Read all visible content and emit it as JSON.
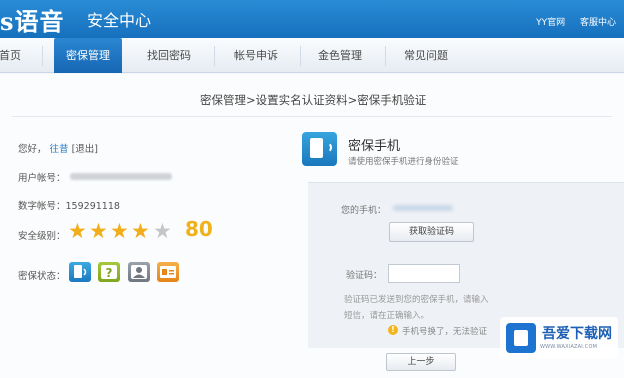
{
  "header": {
    "logo": "s语音",
    "title": "安全中心",
    "links": [
      "YY官网",
      "客服中心"
    ]
  },
  "nav": {
    "items": [
      "首页",
      "密保管理",
      "找回密码",
      "帐号申诉",
      "金色管理",
      "常见问题"
    ],
    "active_index": 1
  },
  "breadcrumb": "密保管理>设置实名认证资料>密保手机验证",
  "left": {
    "greeting": "您好，",
    "username": "往昔",
    "logout": "[退出]",
    "account_label": "用户帐号：",
    "number_label": "数字帐号：",
    "number_value": "159291118",
    "level_label": "安全级别：",
    "stars": 4,
    "stars_total": 5,
    "score": "80",
    "status_label": "密保状态：",
    "status_icons": [
      "phone-icon",
      "question-icon",
      "identity-icon",
      "card-icon"
    ]
  },
  "right": {
    "title": "密保手机",
    "subtitle": "请使用密保手机进行身份验证",
    "phone_label": "您的手机：",
    "get_code_button": "获取验证码",
    "code_label": "验证码：",
    "hint_line1": "验证码已发送到您的密保手机，请输入",
    "hint_line2": "短信，请在正确输入。",
    "phone_changed": "手机号换了，无法验证",
    "prev_button": "上一步"
  },
  "watermark": {
    "name": "吾爱下载网",
    "url": "WWW.WAXIAZAI.COM"
  },
  "colors": {
    "header_blue": "#1c7cc9",
    "link_blue": "#2a7cc7",
    "star_gold": "#f2ad1a"
  }
}
